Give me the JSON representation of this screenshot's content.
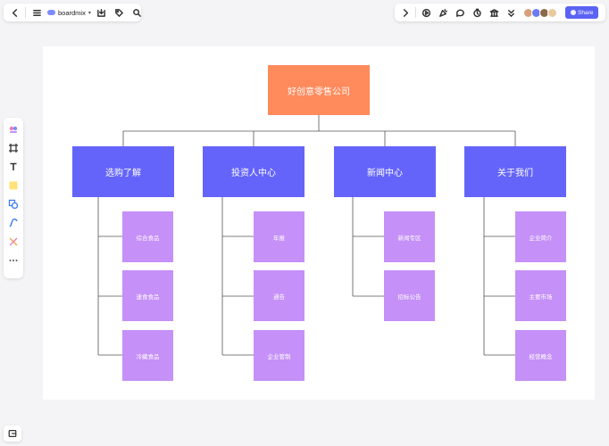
{
  "app": {
    "brand": "boardmix"
  },
  "toolbar": {
    "share_label": "Share"
  },
  "colors": {
    "root": "#ff8a5b",
    "dept": "#6464fa",
    "sub": "#c590f7",
    "accent": "#5b63f5"
  },
  "chart": {
    "root": "好创意零售公司",
    "depts": [
      "选购了解",
      "投资人中心",
      "新闻中心",
      "关于我们"
    ],
    "subs": [
      [
        "综合食品",
        "速食食品",
        "冷藏食品"
      ],
      [
        "年报",
        "通告",
        "企业管制"
      ],
      [
        "新闻专区",
        "招标公告"
      ],
      [
        "企业简介",
        "主要市场",
        "经营概念"
      ]
    ]
  }
}
